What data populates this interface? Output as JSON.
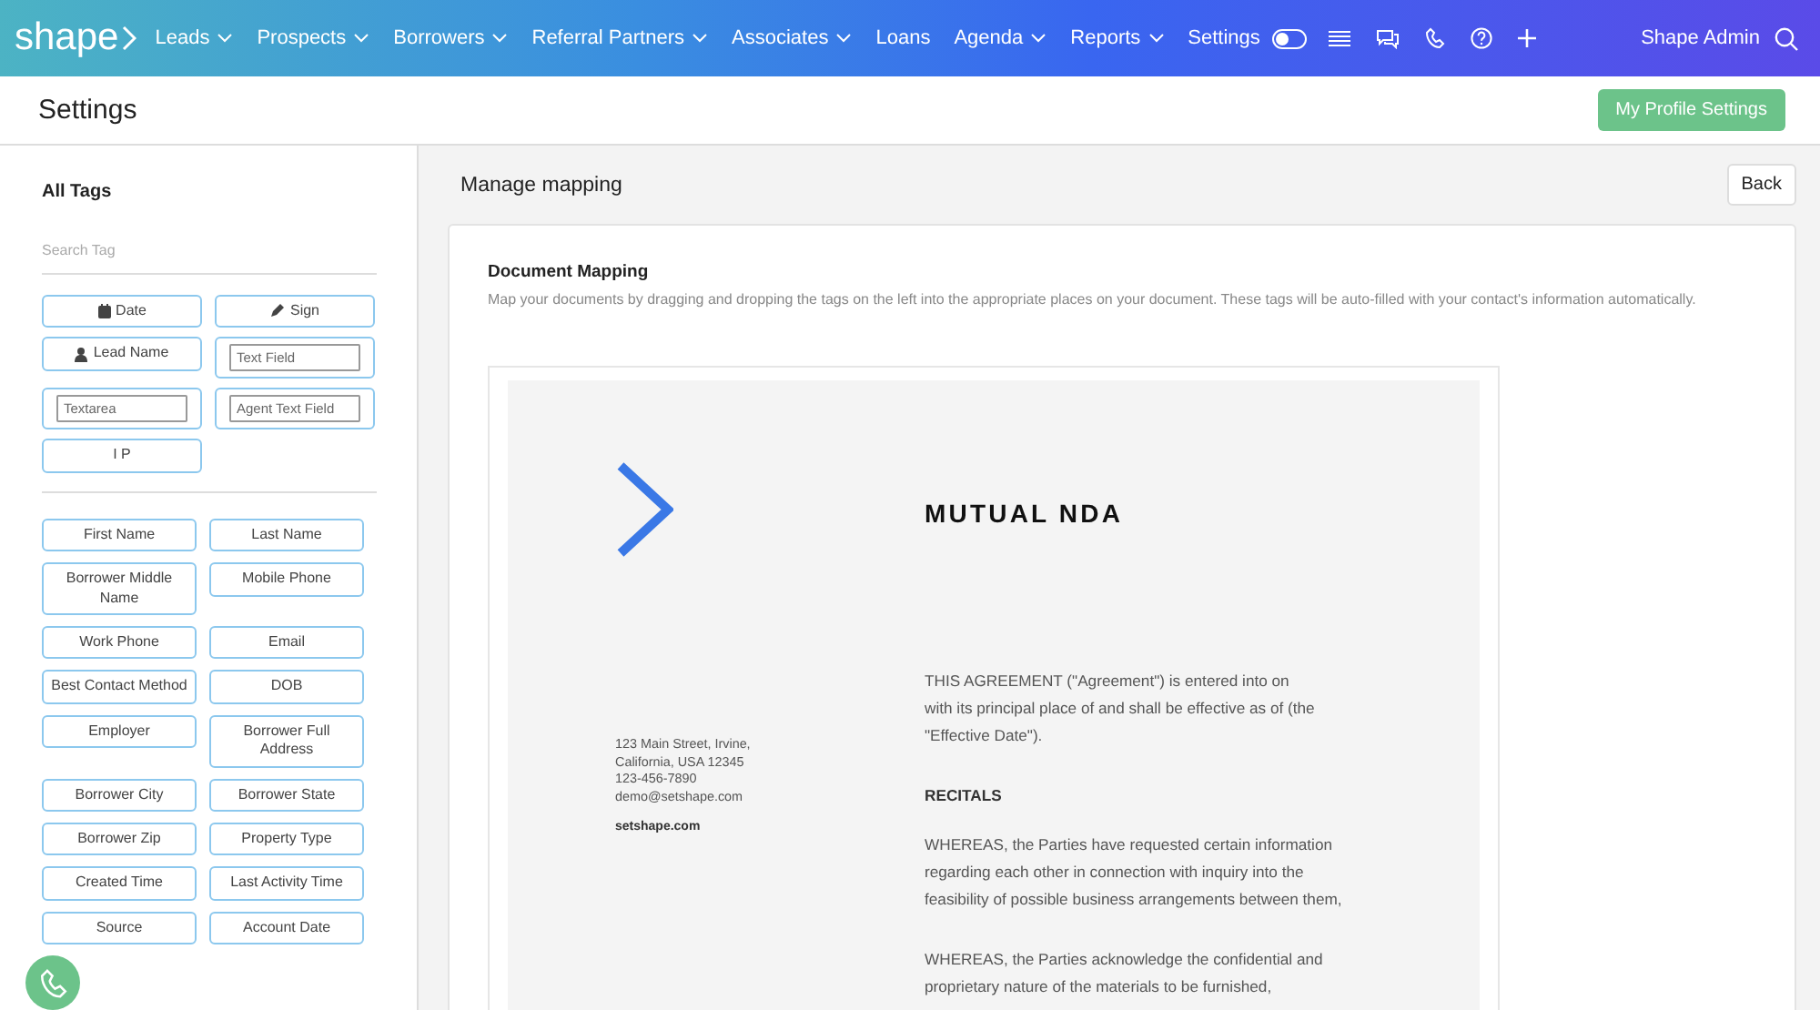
{
  "nav": {
    "logo": "shape",
    "items": [
      {
        "label": "Leads",
        "dropdown": true
      },
      {
        "label": "Prospects",
        "dropdown": true
      },
      {
        "label": "Borrowers",
        "dropdown": true
      },
      {
        "label": "Referral Partners",
        "dropdown": true
      },
      {
        "label": "Associates",
        "dropdown": true
      },
      {
        "label": "Loans",
        "dropdown": false
      },
      {
        "label": "Agenda",
        "dropdown": true
      },
      {
        "label": "Reports",
        "dropdown": true
      },
      {
        "label": "Settings",
        "dropdown": false
      }
    ],
    "toggle": {
      "on": false
    },
    "user": "Shape Admin"
  },
  "header": {
    "title": "Settings",
    "profile_button": "My Profile Settings"
  },
  "sidebar": {
    "title": "All Tags",
    "search_placeholder": "Search Tag",
    "system_tags": [
      {
        "label": "Date",
        "kind": "date"
      },
      {
        "label": "Sign",
        "kind": "signature"
      },
      {
        "label": "Lead Name",
        "kind": "contact"
      },
      {
        "placeholder": "Text Field",
        "kind": "input"
      },
      {
        "placeholder": "Textarea",
        "kind": "input"
      },
      {
        "placeholder": "Agent Text Field",
        "kind": "input"
      },
      {
        "label": "I P",
        "kind": "plain"
      }
    ],
    "contact_tags": [
      "First Name",
      "Last Name",
      "Borrower Middle Name",
      "Mobile Phone",
      "Work Phone",
      "Email",
      "Best Contact Method",
      "DOB",
      "Employer",
      "Borrower Full Address",
      "Borrower City",
      "Borrower State",
      "Borrower Zip",
      "Property Type",
      "Created Time",
      "Last Activity Time",
      "Source",
      "Account Date"
    ]
  },
  "main": {
    "title": "Manage mapping",
    "back_button": "Back",
    "section_title": "Document Mapping",
    "description": "Map your documents by dragging and dropping the tags on the left into the appropriate places on your document. These tags will be auto-filled with your contact's information automatically.",
    "document": {
      "title": "MUTUAL NDA",
      "address_lines": [
        "123 Main Street, Irvine,",
        "California, USA 12345",
        "123-456-7890",
        "demo@setshape.com"
      ],
      "website": "setshape.com",
      "paragraphs": [
        {
          "kind": "text",
          "lines": [
            "THIS AGREEMENT (\"Agreement\") is entered into on",
            "with its principal place of and shall be effective as of (the",
            "\"Effective Date\")."
          ]
        },
        {
          "kind": "heading",
          "lines": [
            "RECITALS"
          ]
        },
        {
          "kind": "text",
          "lines": [
            "WHEREAS, the Parties have requested certain information",
            "regarding each other in connection with inquiry into the",
            "feasibility of possible business arrangements between them,"
          ]
        },
        {
          "kind": "text",
          "lines": [
            "WHEREAS, the Parties acknowledge the confidential and",
            "proprietary nature of the materials to be furnished,"
          ]
        }
      ]
    }
  }
}
